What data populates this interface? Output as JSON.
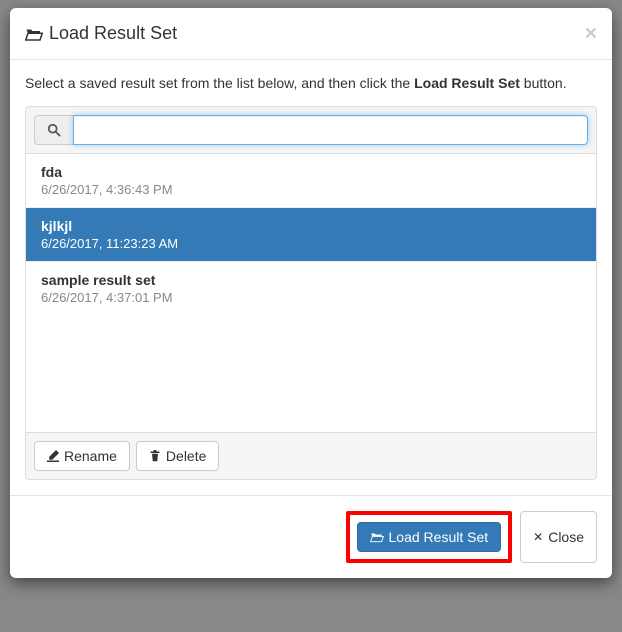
{
  "modal": {
    "title": "Load Result Set",
    "instruction_prefix": "Select a saved result set from the list below, and then click the ",
    "instruction_bold": "Load Result Set",
    "instruction_suffix": " button.",
    "search": {
      "value": "",
      "placeholder": ""
    }
  },
  "results": [
    {
      "name": "fda",
      "timestamp": "6/26/2017, 4:36:43 PM",
      "selected": false
    },
    {
      "name": "kjlkjl",
      "timestamp": "6/26/2017, 11:23:23 AM",
      "selected": true
    },
    {
      "name": "sample result set",
      "timestamp": "6/26/2017, 4:37:01 PM",
      "selected": false
    }
  ],
  "buttons": {
    "rename": "Rename",
    "delete": "Delete",
    "load": "Load Result Set",
    "close": "Close"
  }
}
